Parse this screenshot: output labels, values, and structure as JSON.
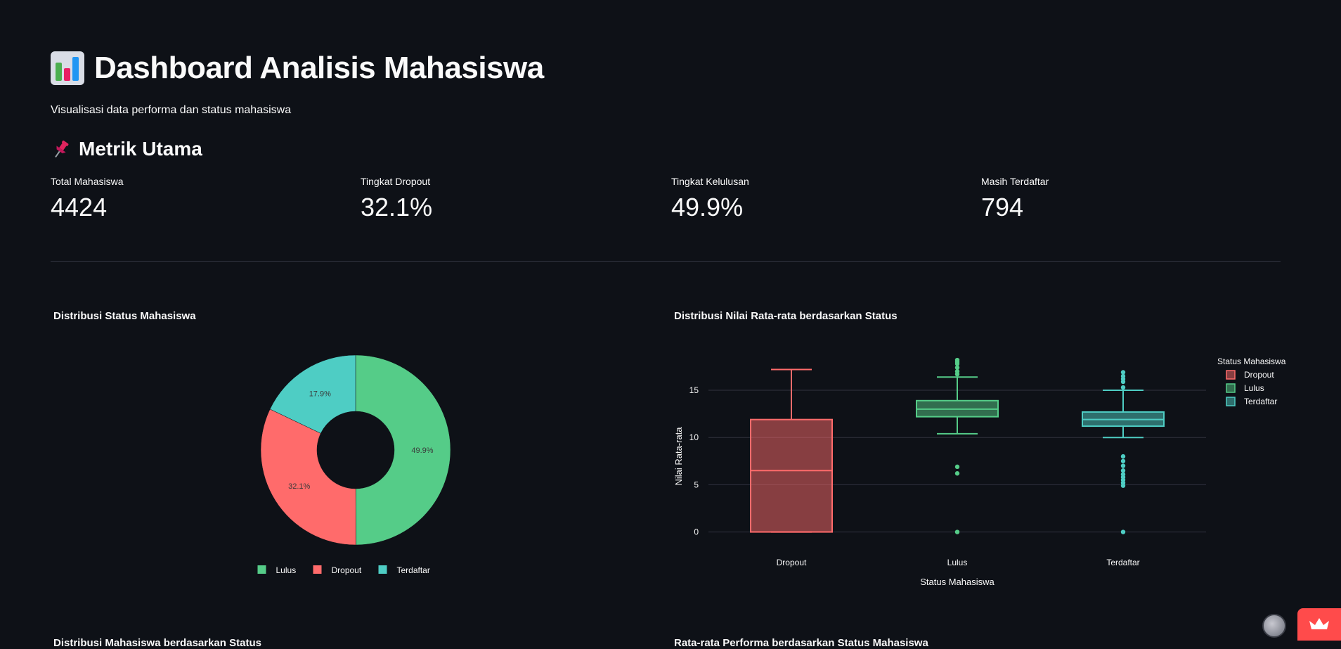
{
  "header": {
    "icon": "bar-chart-icon",
    "title": "Dashboard Analisis Mahasiswa",
    "subtitle": "Visualisasi data performa dan status mahasiswa"
  },
  "metrics_section": {
    "icon": "pushpin-icon",
    "title": "Metrik Utama",
    "items": [
      {
        "label": "Total Mahasiswa",
        "value": "4424"
      },
      {
        "label": "Tingkat Dropout",
        "value": "32.1%"
      },
      {
        "label": "Tingkat Kelulusan",
        "value": "49.9%"
      },
      {
        "label": "Masih Terdaftar",
        "value": "794"
      }
    ]
  },
  "colors": {
    "background": "#0e1117",
    "lulus": "#55cc88",
    "dropout": "#ff6b6b",
    "terdaftar": "#4ecdc4"
  },
  "chart_data": [
    {
      "type": "pie",
      "title": "Distribusi Status Mahasiswa",
      "hole": true,
      "slices": [
        {
          "label": "Lulus",
          "value": 49.9,
          "text": "49.9%",
          "color": "#55cc88"
        },
        {
          "label": "Dropout",
          "value": 32.1,
          "text": "32.1%",
          "color": "#ff6b6b"
        },
        {
          "label": "Terdaftar",
          "value": 17.9,
          "text": "17.9%",
          "color": "#4ecdc4"
        }
      ],
      "legend": [
        "Lulus",
        "Dropout",
        "Terdaftar"
      ],
      "legend_position": "bottom"
    },
    {
      "type": "box",
      "title": "Distribusi Nilai Rata-rata berdasarkan Status",
      "xlabel": "Status Mahasiswa",
      "ylabel": "Nilai Rata-rata",
      "ylim": [
        -1,
        18.5
      ],
      "yticks": [
        0,
        5,
        10,
        15
      ],
      "grid": true,
      "legend_title": "Status Mahasiswa",
      "legend_position": "top-right",
      "categories": [
        "Dropout",
        "Lulus",
        "Terdaftar"
      ],
      "series": [
        {
          "name": "Dropout",
          "color": "#ff6b6b",
          "min": 0,
          "q1": 0,
          "median": 6.5,
          "q3": 11.9,
          "max": 17.2,
          "outliers": []
        },
        {
          "name": "Lulus",
          "color": "#55cc88",
          "min": 10.4,
          "q1": 12.2,
          "median": 13.0,
          "q3": 13.9,
          "max": 16.4,
          "outliers": [
            16.7,
            17.0,
            17.4,
            17.8,
            18.0,
            18.2,
            6.9,
            6.2,
            0
          ]
        },
        {
          "name": "Terdaftar",
          "color": "#4ecdc4",
          "min": 10.0,
          "q1": 11.2,
          "median": 11.9,
          "q3": 12.7,
          "max": 15.0,
          "outliers": [
            15.3,
            15.9,
            16.2,
            16.5,
            16.9,
            8.0,
            7.5,
            7.0,
            6.5,
            6.1,
            5.8,
            5.5,
            5.2,
            4.9,
            0
          ]
        }
      ]
    }
  ],
  "below_fold": {
    "left_title": "Distribusi Mahasiswa berdasarkan Status",
    "right_title": "Rata-rata Performa berdasarkan Status Mahasiswa"
  }
}
